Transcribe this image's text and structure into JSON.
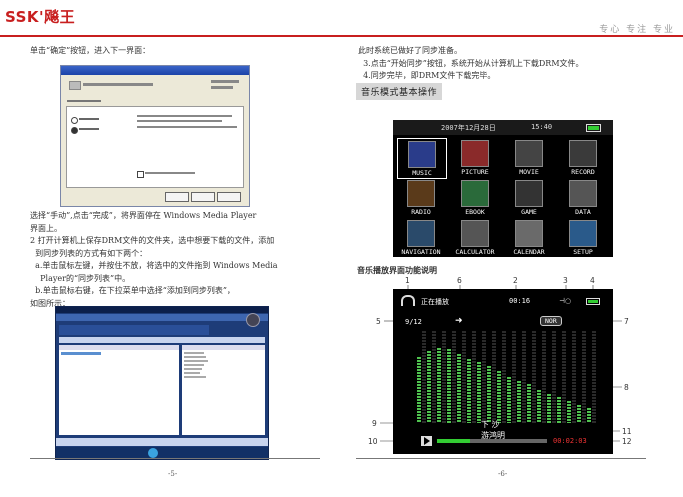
{
  "header": {
    "brand": "SSK'飚王",
    "slogan": "专心 专注 专业"
  },
  "left": {
    "para1": "单击“确定”按钮，进入下一界面：",
    "para2_lines": [
      "选择“手动”,点击“完成”，将界面停在 Windows Media Player",
      "界面上。",
      "2 打开计算机上保存DRM文件的文件夹，选中想要下载的文件，添加",
      "  到同步列表的方式有如下两个：",
      "  a.单击鼠标左键，并按住不放，将选中的文件拖到 Windows Media",
      "    Player的“同步列表”中。",
      "  b.单击鼠标右键，在下拉菜单中选择“添加到同步列表”，",
      "如图所示："
    ],
    "page_number": "-5-"
  },
  "right": {
    "para_lines": [
      "此时系统已做好了同步准备。",
      "  3.点击“开始同步”按钮，系统开始从计算机上下载DRM文件。",
      "  4.同步完毕，即DRM文件下载完毕。"
    ],
    "section_title": "音乐模式基本操作",
    "interface_title": "音乐播放界面功能说明",
    "page_number": "-6-"
  },
  "device": {
    "date": "2007年12月28日",
    "time": "15:40",
    "tiles": [
      {
        "label": "MUSIC",
        "icon": "music-icon"
      },
      {
        "label": "PICTURE",
        "icon": "picture-icon"
      },
      {
        "label": "MOVIE",
        "icon": "movie-icon"
      },
      {
        "label": "RECORD",
        "icon": "microphone-icon"
      },
      {
        "label": "RADIO",
        "icon": "radio-icon"
      },
      {
        "label": "EBOOK",
        "icon": "ebook-icon"
      },
      {
        "label": "GAME",
        "icon": "gamepad-icon"
      },
      {
        "label": "DATA",
        "icon": "sd-card-icon"
      },
      {
        "label": "NAVIGATION",
        "icon": "navigation-icon"
      },
      {
        "label": "CALCULATOR",
        "icon": "calculator-icon"
      },
      {
        "label": "CALENDAR",
        "icon": "calendar-icon"
      },
      {
        "label": "SETUP",
        "icon": "gear-icon"
      }
    ]
  },
  "player": {
    "status": "正在播放",
    "elapsed": "00:16",
    "track_index": "9/12",
    "eq_mode": "NOR",
    "song_title": "下 沙",
    "artist": "游鸿明",
    "total_time": "00:02:03"
  },
  "callouts": [
    "1",
    "6",
    "2",
    "3",
    "4",
    "5",
    "7",
    "8",
    "9",
    "10",
    "11",
    "12"
  ],
  "eq_levels": [
    0.72,
    0.78,
    0.82,
    0.8,
    0.75,
    0.7,
    0.66,
    0.62,
    0.56,
    0.5,
    0.46,
    0.42,
    0.36,
    0.32,
    0.28,
    0.24,
    0.2,
    0.16
  ]
}
